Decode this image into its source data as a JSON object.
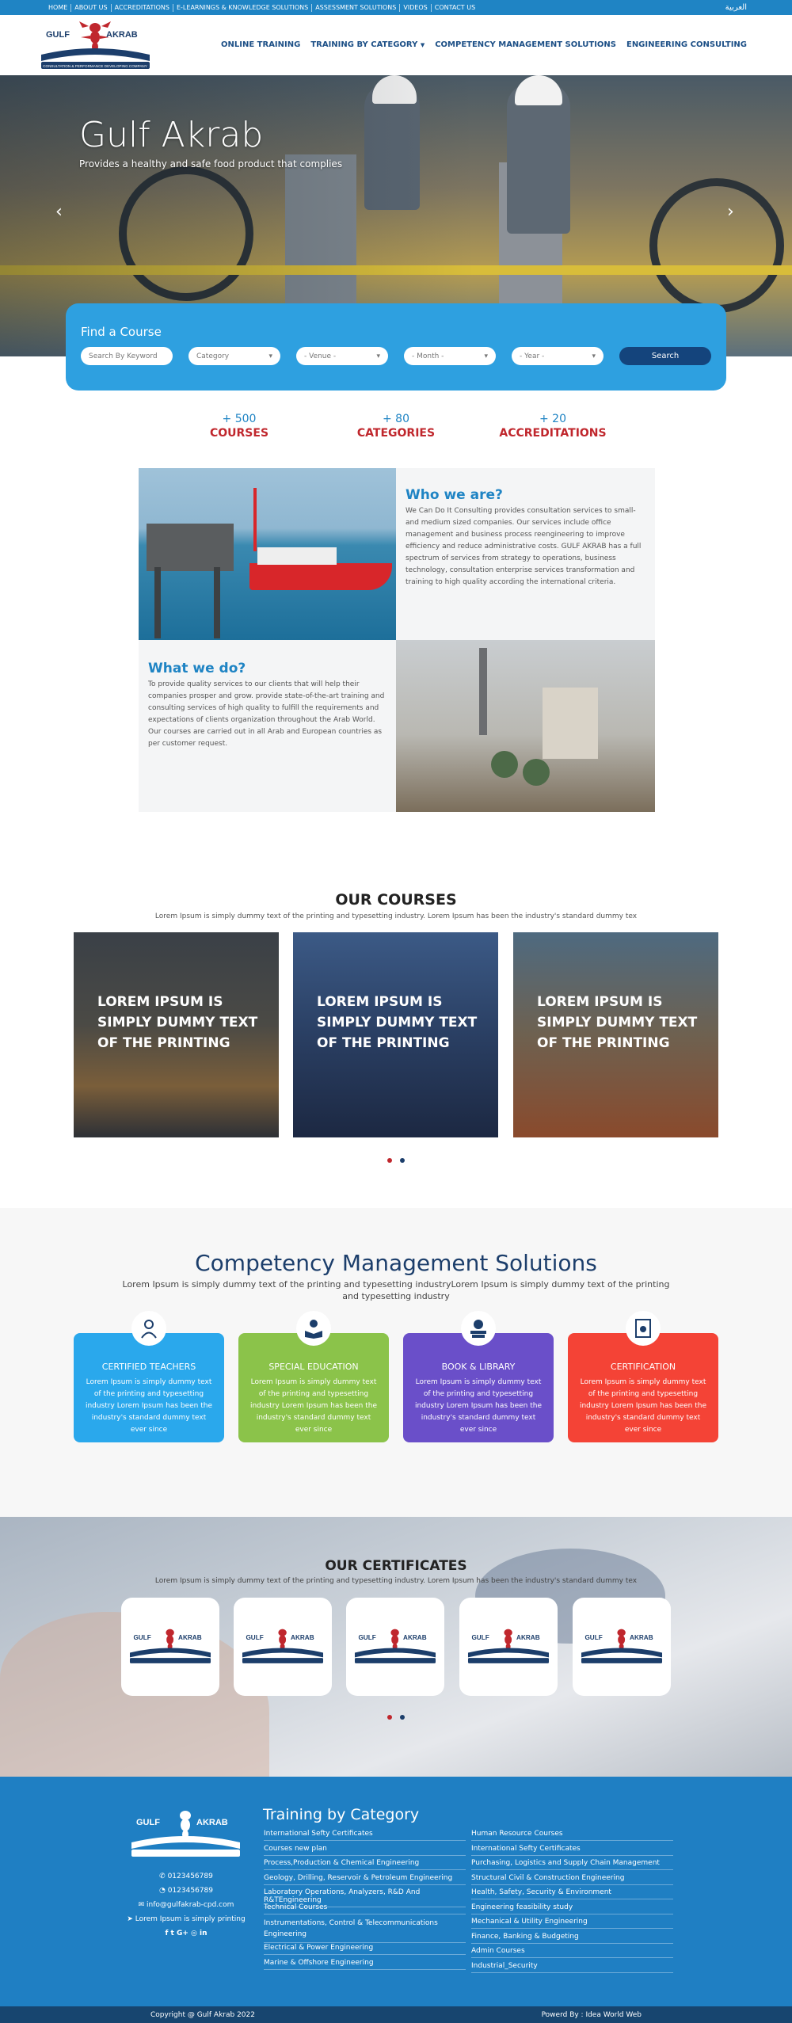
{
  "topbar": {
    "links": [
      "HOME",
      "ABOUT US",
      "ACCREDITATIONS",
      "E-LEARNINGS & KNOWLEDGE SOLUTIONS",
      "ASSESSMENT SOLUTIONS",
      "VIDEOS",
      "CONTACT US"
    ],
    "lang": "العربية"
  },
  "logo": {
    "text_left": "GULF",
    "text_right": "AKRAB",
    "tagline": "CONSULTATION & PERFORMANCE DEVELOPING COMPANY"
  },
  "nav": [
    "ONLINE TRAINING",
    "TRAINING BY CATEGORY",
    "COMPETENCY MANAGEMENT SOLUTIONS",
    "ENGINEERING CONSULTING"
  ],
  "hero": {
    "title": "Gulf Akrab",
    "subtitle": "Provides a healthy and safe food product that complies"
  },
  "find": {
    "title": "Find a Course",
    "keyword_placeholder": "Search By Keyword",
    "category": "Category",
    "venue": "- Venue -",
    "month": "- Month -",
    "year": "- Year -",
    "button": "Search"
  },
  "stats": [
    {
      "number": "+ 500",
      "label": "COURSES"
    },
    {
      "number": "+ 80",
      "label": "CATEGORIES"
    },
    {
      "number": "+ 20",
      "label": "ACCREDITATIONS"
    }
  ],
  "who": {
    "title": "Who we are?",
    "text": "We Can Do It Consulting provides consultation services to small- and medium sized companies. Our services include office management and business process reengineering to improve efficiency and reduce administrative costs. GULF AKRAB has a full spectrum of services from strategy to operations, business technology, consultation enterprise services transformation and training to high quality according the international criteria."
  },
  "what": {
    "title": "What we do?",
    "text": "To provide quality services to our clients that will help their companies prosper and grow. provide state-of-the-art training and consulting services of high quality to fulfill the requirements and expectations of clients organization throughout the Arab World. Our courses are carried out in all Arab and European countries as per customer request."
  },
  "courses": {
    "title": "OUR COURSES",
    "subtitle": "Lorem Ipsum is simply dummy text of the printing and typesetting industry. Lorem Ipsum has been the industry's standard dummy tex",
    "items": [
      "LOREM IPSUM IS SIMPLY DUMMY TEXT OF THE PRINTING",
      "LOREM IPSUM IS SIMPLY DUMMY TEXT OF THE PRINTING",
      "LOREM IPSUM IS SIMPLY DUMMY TEXT OF THE PRINTING"
    ]
  },
  "competency": {
    "title": "Competency Management Solutions",
    "subtitle": "Lorem Ipsum is simply dummy text of the printing and typesetting industryLorem Ipsum is simply dummy text of the printing and typesetting industry",
    "cards": [
      {
        "title": "CERTIFIED TEACHERS",
        "text": "Lorem Ipsum is simply dummy text of the printing and typesetting industry Lorem Ipsum has been the industry's standard dummy text ever since",
        "color": "#2aa8ec"
      },
      {
        "title": "SPECIAL EDUCATION",
        "text": "Lorem Ipsum is simply dummy text of the printing and typesetting industry Lorem Ipsum has been the industry's standard dummy text ever since",
        "color": "#8bc34a"
      },
      {
        "title": "BOOK & LIBRARY",
        "text": "Lorem Ipsum is simply dummy text of the printing and typesetting industry Lorem Ipsum has been the industry's standard dummy text ever since",
        "color": "#6a4fc9"
      },
      {
        "title": "CERTIFICATION",
        "text": "Lorem Ipsum is simply dummy text of the printing and typesetting industry Lorem Ipsum has been the industry's standard dummy text ever since",
        "color": "#f44336"
      }
    ]
  },
  "certificates": {
    "title": "OUR CERTIFICATES",
    "subtitle": "Lorem Ipsum is simply dummy text of the printing and typesetting industry. Lorem Ipsum has been the industry's standard dummy tex"
  },
  "footer": {
    "phone": "0123456789",
    "whatsapp": "0123456789",
    "email": "info@gulfakrab-cpd.com",
    "address": "Lorem Ipsum is simply printing",
    "social": "f  t  G+  ◎  in",
    "title": "Training by Category",
    "col1": [
      "International Sefty Certificates",
      "Courses new plan",
      "Process,Production & Chemical Engineering",
      "Geology, Drilling, Reservoir & Petroleum Engineering",
      "Laboratory Operations, Analyzers, R&D And R&TEngineering",
      "Technical Courses",
      "Instrumentations, Control & Telecommunications Engineering",
      "Electrical & Power Engineering",
      "Marine & Offshore Engineering"
    ],
    "col2": [
      "Human Resource Courses",
      "International Sefty Certificates",
      "Purchasing, Logistics and Supply Chain Management",
      "Structural Civil & Construction Engineering",
      "Health, Safety, Security & Environment",
      "Engineering feasibility study",
      "Mechanical & Utility Engineering",
      "Finance, Banking & Budgeting",
      "Admin Courses",
      "Industrial_Security"
    ],
    "copyright": "Copyright @ Gulf Akrab 2022",
    "powered": "Powerd By : Idea World Web"
  }
}
